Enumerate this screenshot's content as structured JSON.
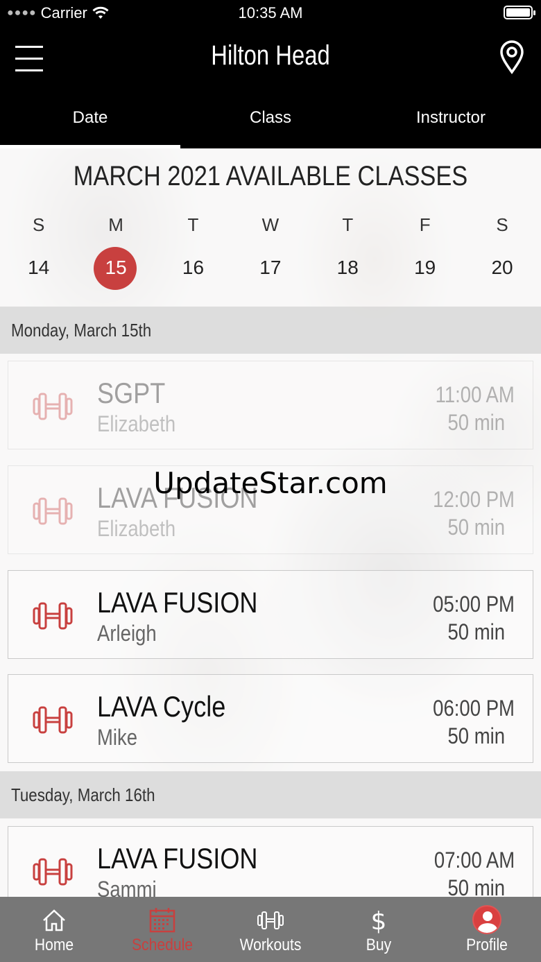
{
  "status_bar": {
    "carrier": "Carrier",
    "time": "10:35 AM"
  },
  "header": {
    "title": "Hilton Head"
  },
  "tabs": [
    {
      "label": "Date",
      "active": true
    },
    {
      "label": "Class",
      "active": false
    },
    {
      "label": "Instructor",
      "active": false
    }
  ],
  "calendar": {
    "title": "MARCH 2021 AVAILABLE CLASSES",
    "weekday_letters": [
      "S",
      "M",
      "T",
      "W",
      "T",
      "F",
      "S"
    ],
    "dates": [
      "14",
      "15",
      "16",
      "17",
      "18",
      "19",
      "20"
    ],
    "selected_date": "15"
  },
  "schedule": [
    {
      "day": "Monday, March 15th",
      "classes": [
        {
          "name": "SGPT",
          "instructor": "Elizabeth",
          "time": "11:00 AM",
          "duration": "50 min",
          "past": true
        },
        {
          "name": "LAVA FUSION",
          "instructor": "Elizabeth",
          "time": "12:00 PM",
          "duration": "50 min",
          "past": true
        },
        {
          "name": "LAVA FUSION",
          "instructor": "Arleigh",
          "time": "05:00 PM",
          "duration": "50 min",
          "past": false
        },
        {
          "name": "LAVA Cycle",
          "instructor": "Mike",
          "time": "06:00 PM",
          "duration": "50 min",
          "past": false
        }
      ]
    },
    {
      "day": "Tuesday, March 16th",
      "classes": [
        {
          "name": "LAVA FUSION",
          "instructor": "Sammi",
          "time": "07:00 AM",
          "duration": "50 min",
          "past": false
        }
      ]
    }
  ],
  "watermark": "UpdateStar.com",
  "tab_bar": [
    {
      "label": "Home",
      "icon": "home-icon",
      "active": false
    },
    {
      "label": "Schedule",
      "icon": "calendar-icon",
      "active": true
    },
    {
      "label": "Workouts",
      "icon": "dumbbell-icon",
      "active": false
    },
    {
      "label": "Buy",
      "icon": "dollar-icon",
      "active": false
    },
    {
      "label": "Profile",
      "icon": "profile-avatar-icon",
      "active": false
    }
  ],
  "colors": {
    "accent": "#c8403f",
    "tab_bar_bg": "#777777",
    "header_bg": "#000000"
  }
}
